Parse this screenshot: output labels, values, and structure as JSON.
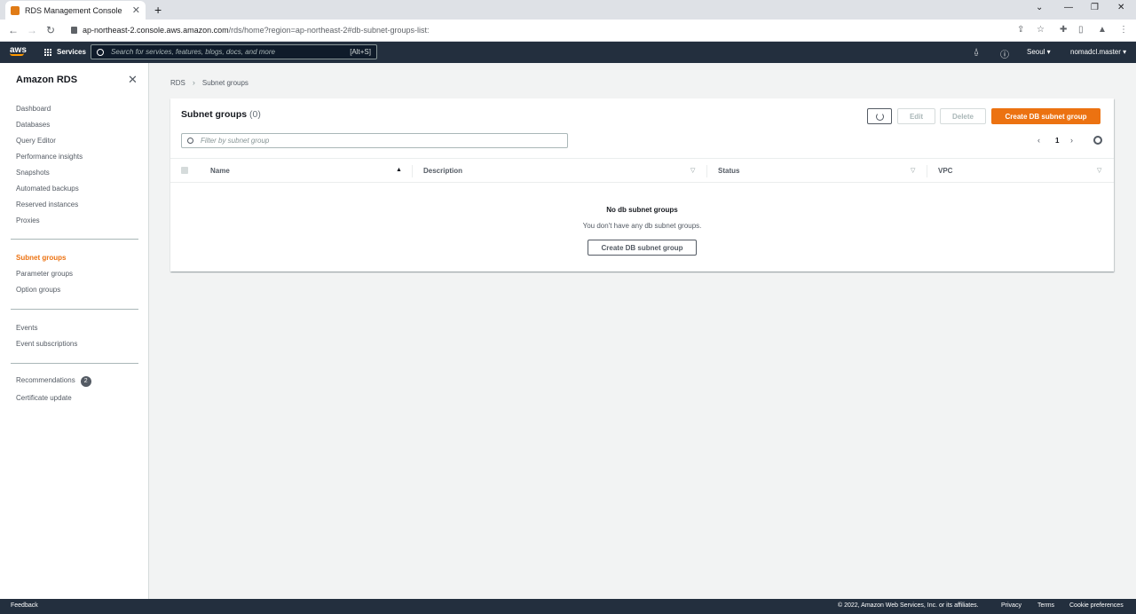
{
  "browser": {
    "tab_title": "RDS Management Console",
    "url_host": "ap-northeast-2.console.aws.amazon.com",
    "url_path": "/rds/home?region=ap-northeast-2#db-subnet-groups-list:"
  },
  "topnav": {
    "logo": "aws",
    "services_label": "Services",
    "search_placeholder": "Search for services, features, blogs, docs, and more",
    "search_shortcut": "[Alt+S]",
    "region": "Seoul ▾",
    "account": "nomadcl.master ▾"
  },
  "sidebar": {
    "title": "Amazon RDS",
    "group1": [
      "Dashboard",
      "Databases",
      "Query Editor",
      "Performance insights",
      "Snapshots",
      "Automated backups",
      "Reserved instances",
      "Proxies"
    ],
    "group2": [
      "Subnet groups",
      "Parameter groups",
      "Option groups"
    ],
    "group3": [
      "Events",
      "Event subscriptions"
    ],
    "recommendations_label": "Recommendations",
    "recommendations_count": "2",
    "certificate_label": "Certificate update",
    "active_item": "Subnet groups"
  },
  "breadcrumb": {
    "root": "RDS",
    "current": "Subnet groups"
  },
  "panel": {
    "title": "Subnet groups",
    "count": "(0)",
    "edit_label": "Edit",
    "delete_label": "Delete",
    "create_label": "Create DB subnet group",
    "filter_placeholder": "Filter by subnet group",
    "page_number": "1",
    "columns": [
      "Name",
      "Description",
      "Status",
      "VPC"
    ],
    "empty_title": "No db subnet groups",
    "empty_desc": "You don't have any db subnet groups.",
    "empty_create_label": "Create DB subnet group"
  },
  "footer": {
    "feedback": "Feedback",
    "copyright": "© 2022, Amazon Web Services, Inc. or its affiliates.",
    "privacy": "Privacy",
    "terms": "Terms",
    "cookies": "Cookie preferences"
  },
  "colors": {
    "accent": "#ec7211",
    "nav_bg": "#232f3e"
  }
}
